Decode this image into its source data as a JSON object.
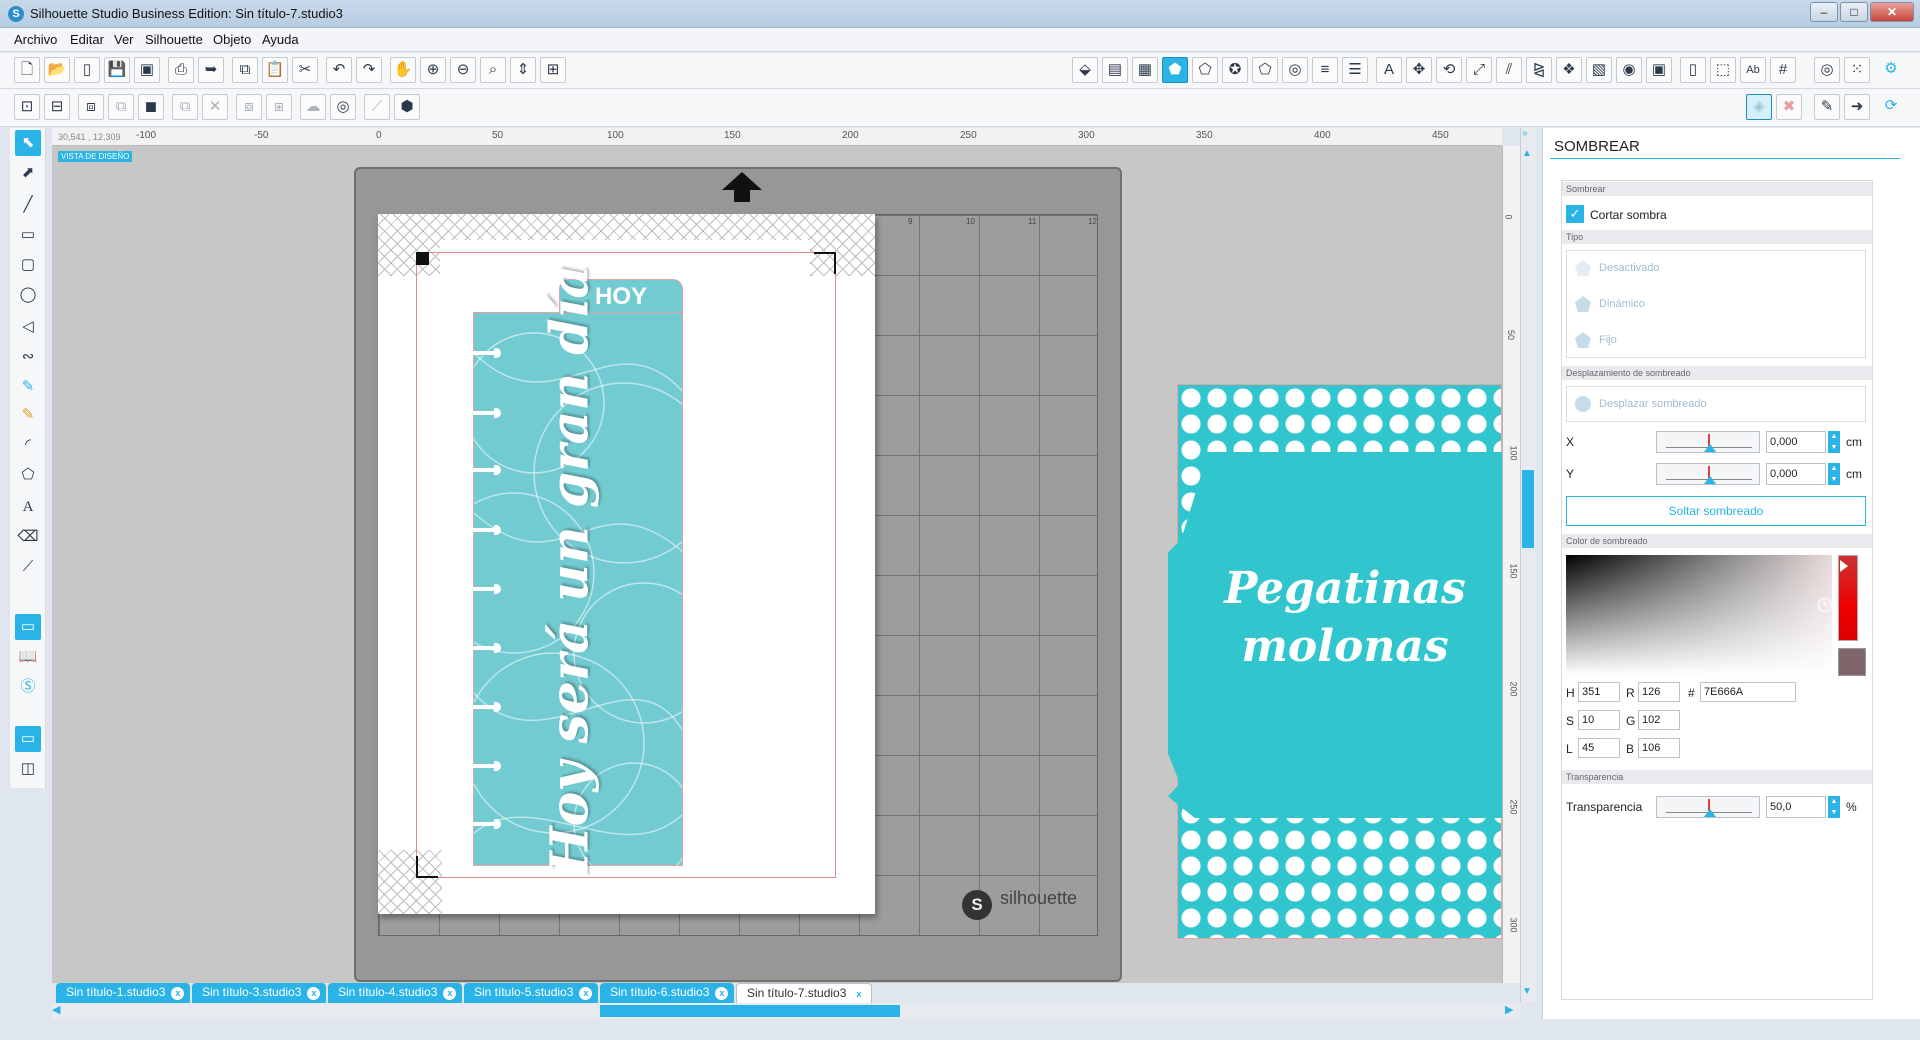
{
  "window": {
    "title": "Silhouette Studio Business Edition: Sin título-7.studio3",
    "app_icon": "S"
  },
  "menu": [
    "Archivo",
    "Editar",
    "Ver",
    "Silhouette",
    "Objeto",
    "Ayuda"
  ],
  "canvas": {
    "coords": "30,541 , 12,309",
    "badge": "VISTA DE DISEÑO",
    "ruler_top": [
      "-100",
      "-50",
      "0",
      "50",
      "100",
      "150",
      "200",
      "250",
      "300",
      "350",
      "400",
      "450"
    ],
    "ruler_right": [
      "0",
      "50",
      "100",
      "150",
      "200",
      "250",
      "300"
    ],
    "mat_cols": [
      "9",
      "10",
      "11",
      "12"
    ],
    "brand": "silhouette",
    "brand_mark": "S"
  },
  "design": {
    "tab_label": "HOY",
    "script_text": "Hoy será un gran día",
    "sticker_text_line1": "Pegatinas",
    "sticker_text_line2": "molonas"
  },
  "doc_tabs": [
    {
      "label": "Sin título-1.studio3",
      "active": false
    },
    {
      "label": "Sin título-3.studio3",
      "active": false
    },
    {
      "label": "Sin título-4.studio3",
      "active": false
    },
    {
      "label": "Sin título-5.studio3",
      "active": false
    },
    {
      "label": "Sin título-6.studio3",
      "active": false
    },
    {
      "label": "Sin título-7.studio3",
      "active": true
    }
  ],
  "panel": {
    "title": "SOMBREAR",
    "section_shadow": "Sombrear",
    "cut_shadow_label": "Cortar sombra",
    "cut_shadow_checked": true,
    "section_type": "Tipo",
    "types": [
      "Desactivado",
      "Dinámico",
      "Fijo"
    ],
    "section_offset": "Desplazamiento de sombreado",
    "offset_button": "Desplazar sombreado",
    "x_label": "X",
    "x_value": "0,000",
    "x_unit": "cm",
    "y_label": "Y",
    "y_value": "0,000",
    "y_unit": "cm",
    "release_button": "Soltar sombreado",
    "section_color": "Color de sombreado",
    "color": {
      "H": "351",
      "S": "10",
      "L": "45",
      "R": "126",
      "G": "102",
      "B": "106",
      "hex": "7E666A",
      "swatch": "#7E666A"
    },
    "section_transparency": "Transparencia",
    "transparency_label": "Transparencia",
    "transparency_value": "50,0",
    "transparency_unit": "%"
  },
  "colors": {
    "accent": "#29B3E6",
    "tab_teal": "#73CBD2",
    "sticker_teal": "#31C6CE"
  }
}
